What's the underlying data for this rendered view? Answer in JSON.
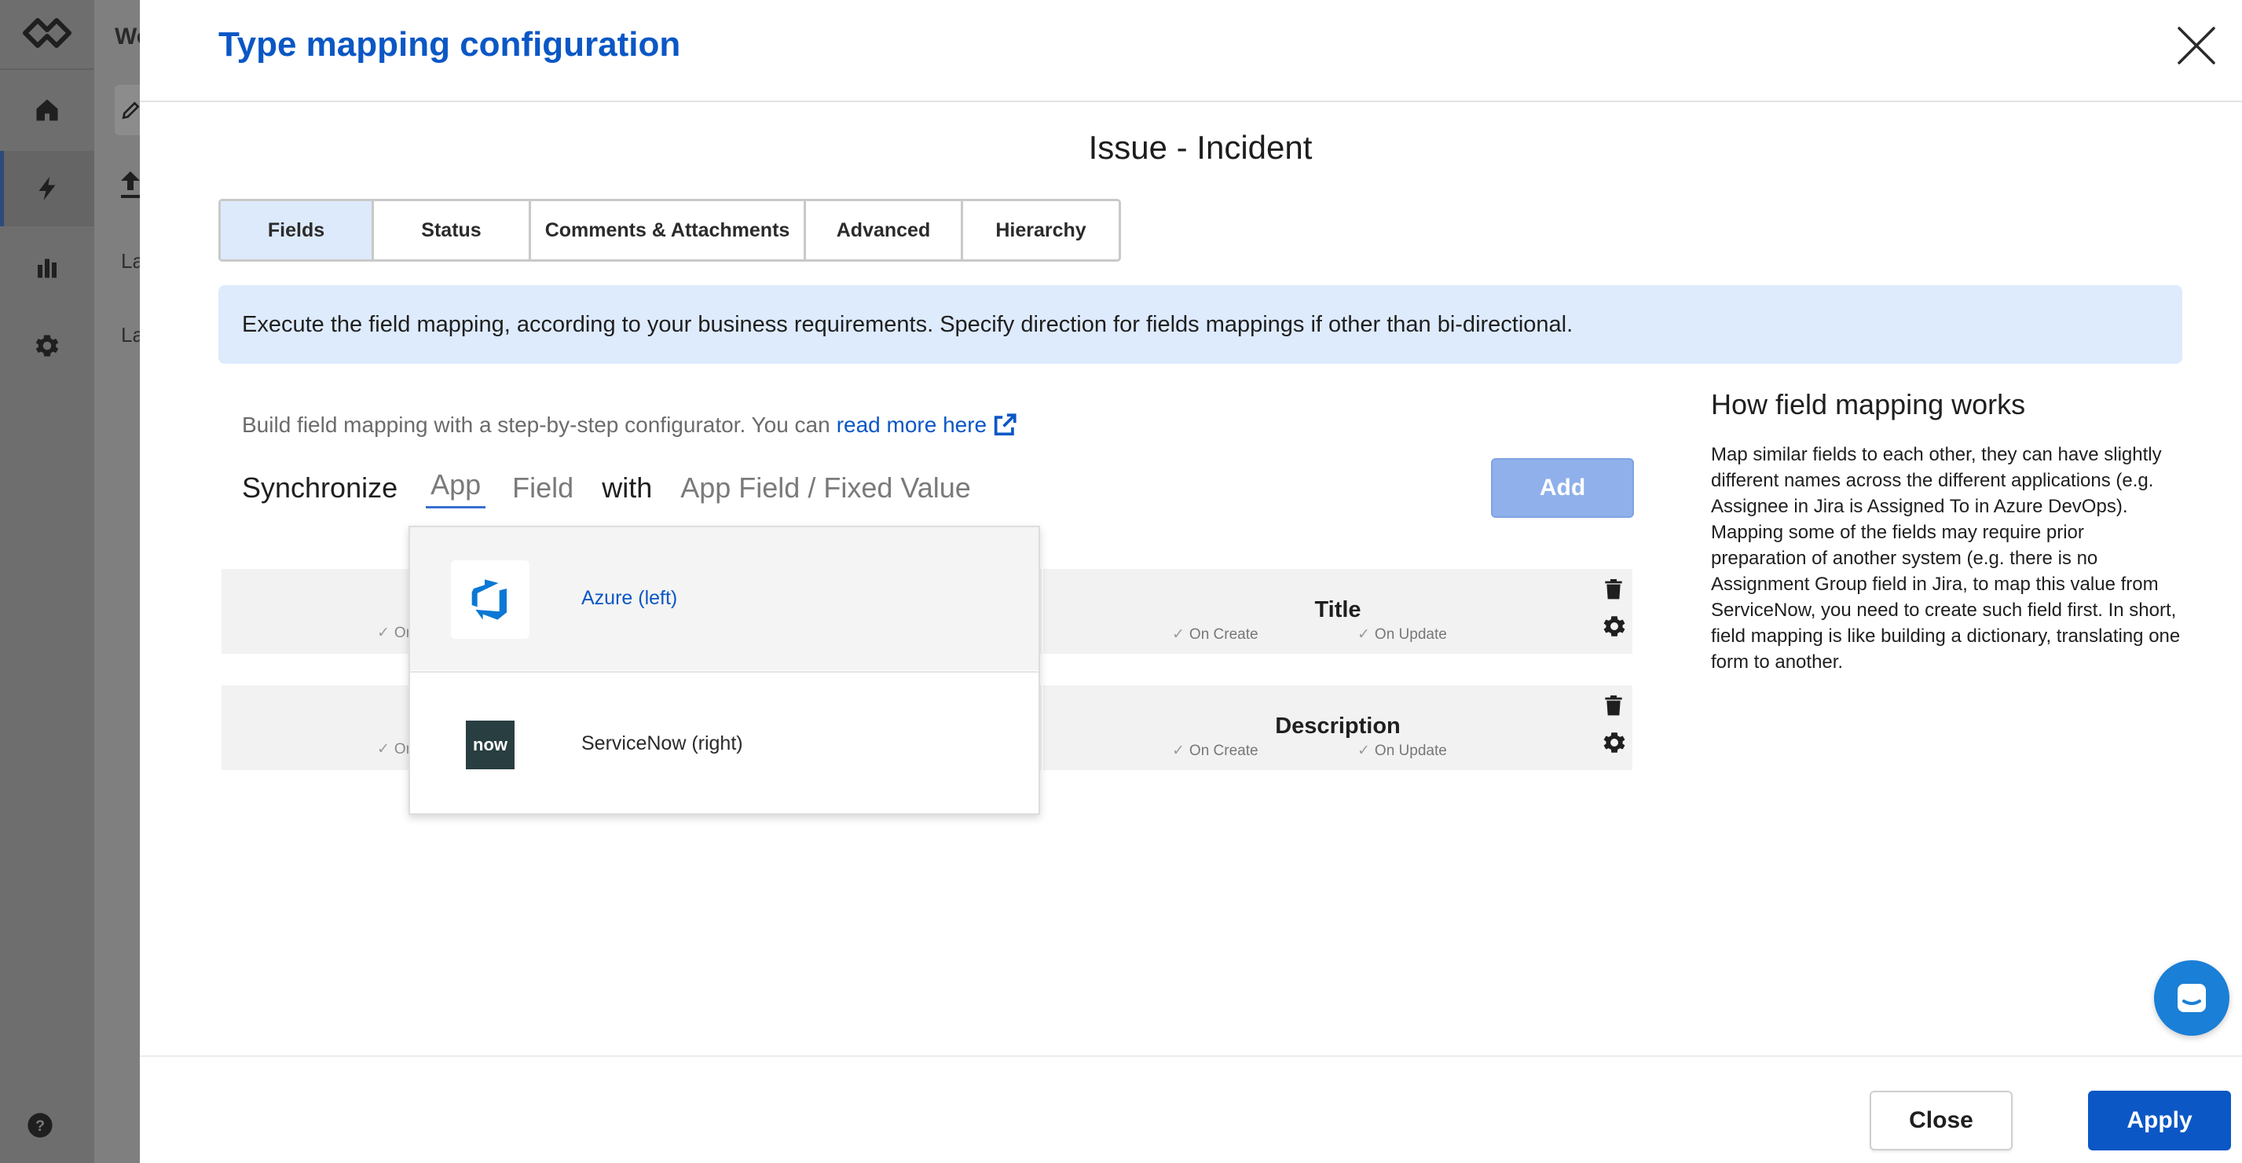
{
  "background": {
    "title_fragment": "Wo",
    "label_1": "La",
    "label_2": "La",
    "nav_items": [
      "home-icon",
      "bolt-icon",
      "bar-chart-icon",
      "gear-icon"
    ]
  },
  "modal": {
    "title": "Type mapping configuration",
    "type_title": "Issue - Incident",
    "tabs": [
      {
        "label": "Fields",
        "active": true
      },
      {
        "label": "Status",
        "active": false
      },
      {
        "label": "Comments & Attachments",
        "active": false
      },
      {
        "label": "Advanced",
        "active": false
      },
      {
        "label": "Hierarchy",
        "active": false
      }
    ],
    "info": "Execute the field mapping, according to your business requirements. Specify direction for fields mappings if other than bi-directional.",
    "builder": {
      "hint": "Build field mapping with a step-by-step configurator. You can",
      "link": "read more here",
      "sync": "Synchronize",
      "app": "App",
      "field": "Field",
      "with": "with",
      "value": "App Field / Fixed Value",
      "add": "Add"
    },
    "mappings": [
      {
        "left_check": "On",
        "field": "Title",
        "on_create": "On Create",
        "on_update": "On Update"
      },
      {
        "left_check": "On",
        "field": "Description",
        "on_create": "On Create",
        "on_update": "On Update"
      }
    ],
    "dropdown": {
      "options": [
        {
          "label": "Azure (left)",
          "icon": "azure-devops-icon",
          "selected": true
        },
        {
          "label": "ServiceNow (right)",
          "icon": "servicenow-icon",
          "logo_text": "now",
          "selected": false
        }
      ]
    },
    "help": {
      "title": "How field mapping works",
      "text": "Map similar fields to each other, they can have slightly different names across the different applications (e.g. Assignee in Jira is Assigned To in Azure DevOps). Mapping some of the fields may require prior preparation of another system (e.g. there is no Assignment Group field in Jira, to map this value from ServiceNow, you need to create such field first. In short, field mapping is like building a dictionary, translating one form to another."
    },
    "footer": {
      "close": "Close",
      "apply": "Apply"
    }
  },
  "colors": {
    "accent": "#0b57c5",
    "tab_active": "#ddeafc",
    "banner": "#deebfd",
    "add_disabled": "#8fb0ea",
    "chat": "#1a7fd6"
  }
}
